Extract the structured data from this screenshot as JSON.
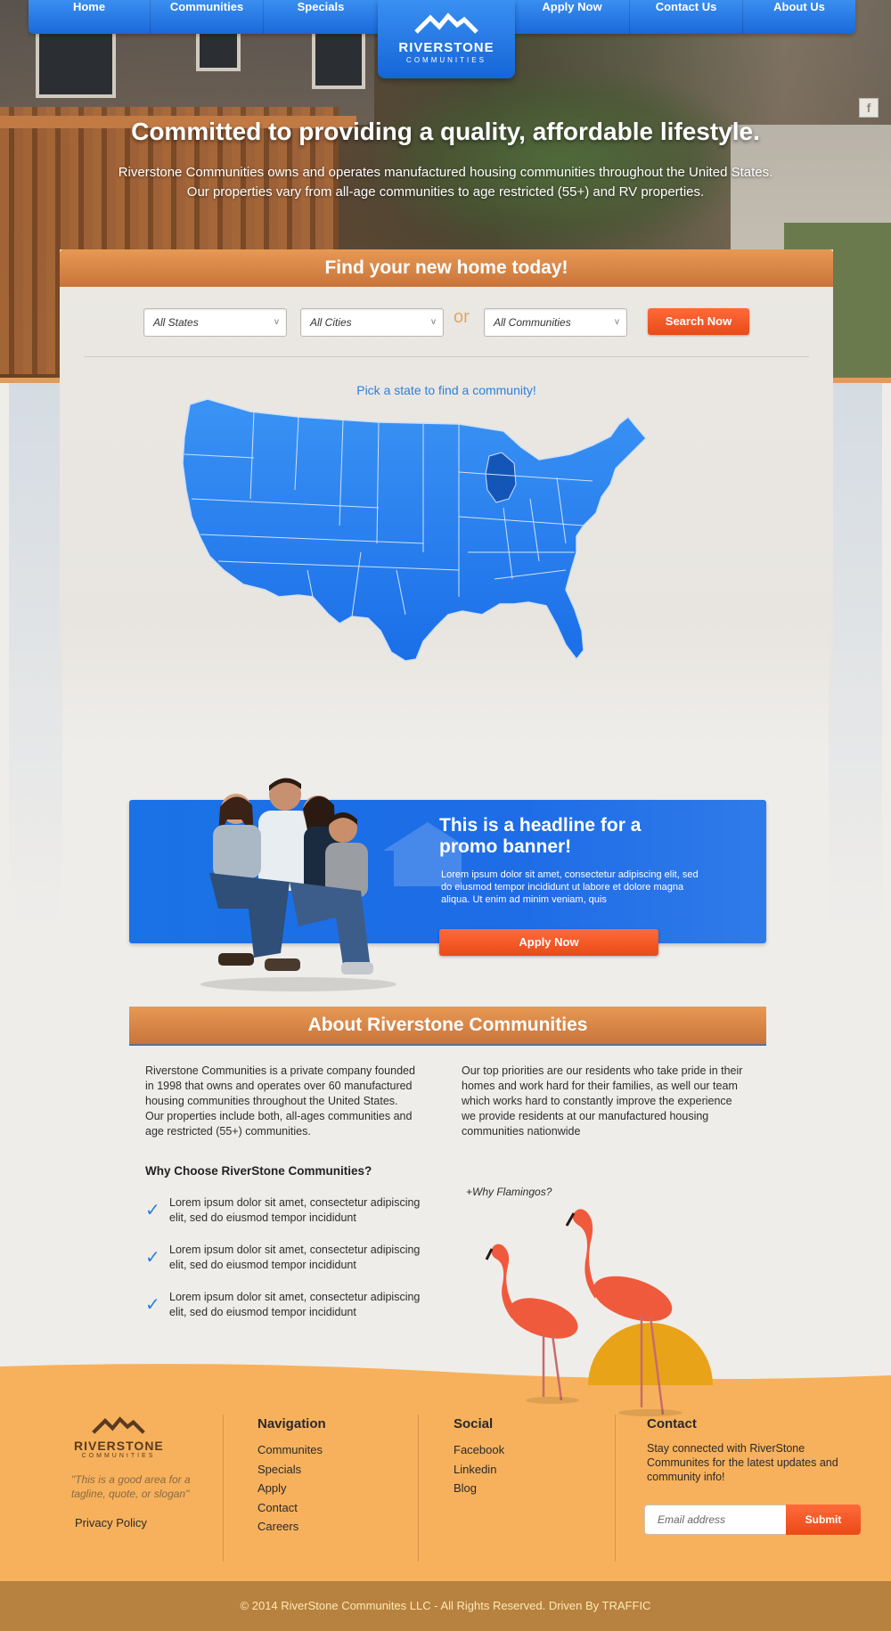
{
  "nav": {
    "items": [
      "Home",
      "Communities",
      "Specials",
      "Apply Now",
      "Contact Us",
      "About Us"
    ]
  },
  "brand": {
    "name": "RIVERSTONE",
    "sub": "COMMUNITIES",
    "icon": "roof-mountains-logo"
  },
  "hero": {
    "title": "Committed to providing a quality, affordable lifestyle.",
    "text": "Riverstone Communities owns and operates manufactured housing communities throughout the United States. Our properties vary from all-age communities to age restricted (55+) and RV properties.",
    "social_icon": "facebook-icon"
  },
  "finder": {
    "title": "Find your new home today!",
    "states_value": "All States",
    "cities_value": "All Cities",
    "or_label": "or",
    "communities_value": "All Communities",
    "search_label": "Search Now",
    "map_caption": "Pick a state to find a community!"
  },
  "promo": {
    "title": "This is a headline for a promo banner!",
    "text": "Lorem ipsum dolor sit amet, consectetur adipiscing elit, sed do eiusmod tempor incididunt ut labore et dolore magna aliqua. Ut enim ad minim veniam, quis",
    "button": "Apply Now"
  },
  "about": {
    "title": "About Riverstone Communities",
    "col1": "Riverstone Communities is a private company founded in 1998 that owns and operates over 60 manufactured housing communities throughout the United States. Our properties include both, all-ages communities and age restricted (55+) communities.",
    "col2": "Our top priorities are our residents who take pride in their homes and work hard for their families, as well our team which works hard to constantly improve the experience we provide residents at our manufactured housing communities nationwide",
    "why_title": "Why Choose RiverStone Communities?",
    "why_items": [
      "Lorem ipsum dolor sit amet, consectetur adipiscing elit, sed do eiusmod tempor incididunt",
      "Lorem ipsum dolor sit amet, consectetur adipiscing elit, sed do eiusmod tempor incididunt",
      "Lorem ipsum dolor sit amet, consectetur adipiscing elit, sed do eiusmod tempor incididunt"
    ],
    "flamingo_link": "+Why Flamingos?"
  },
  "footer": {
    "brand_name": "RIVERSTONE",
    "brand_sub": "COMMUNITIES",
    "tagline": "\"This is a good area for a tagline, quote, or slogan\"",
    "privacy": "Privacy Policy",
    "nav_title": "Navigation",
    "nav_links": [
      "Communites",
      "Specials",
      "Apply",
      "Contact",
      "Careers"
    ],
    "social_title": "Social",
    "social_links": [
      "Facebook",
      "Linkedin",
      "Blog"
    ],
    "contact_title": "Contact",
    "contact_text": "Stay connected with RiverStone Communites for the latest updates and community info!",
    "email_placeholder": "Email address",
    "submit": "Submit",
    "copyright": "© 2014 RiverStone Communites LLC - All Rights Reserved. Driven By TRAFFIC"
  },
  "colors": {
    "nav_blue": "#1a68da",
    "accent_orange": "#ea4a17",
    "header_orange": "#c9743b",
    "footer_orange": "#f7b15c",
    "map_blue": "#2a84f0",
    "map_highlight": "#1456b8"
  }
}
